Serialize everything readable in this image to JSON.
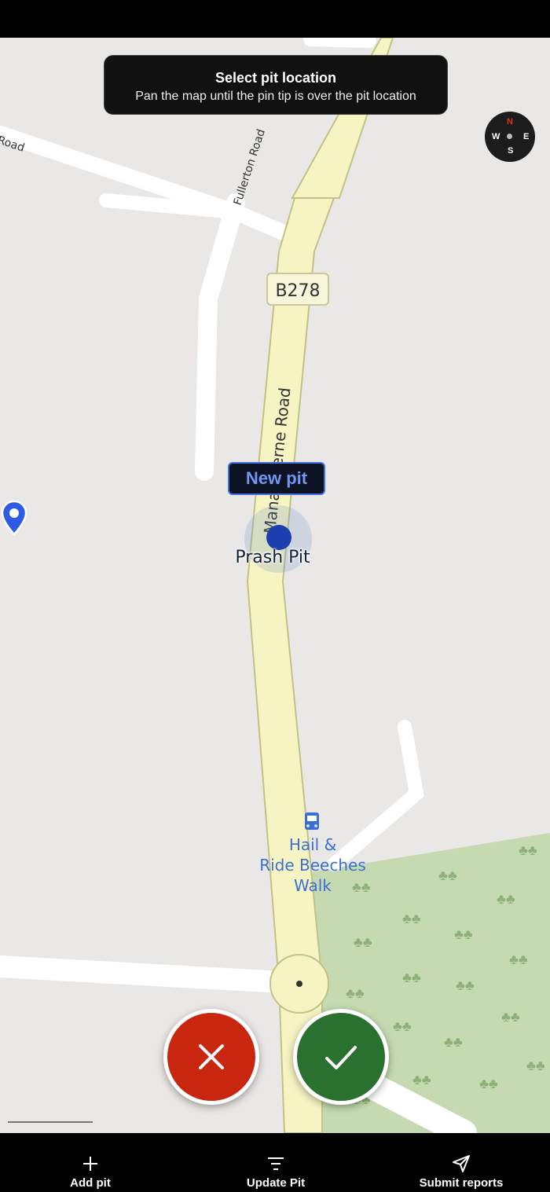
{
  "toast": {
    "title": "Select pit location",
    "subtitle": "Pan the map until the pin tip is over the pit location"
  },
  "compass": {
    "north": "N",
    "south": "S",
    "west": "W",
    "east": "E",
    "north_color": "#e53020"
  },
  "map": {
    "road_labels": {
      "road_left": "Road",
      "fullerton": "Fullerton Road",
      "b278": "B278",
      "manstern": "Manansterne Road"
    },
    "poi": {
      "icon": "bus-stop-icon",
      "line1": "Hail &",
      "line2": "Ride Beeches",
      "line3": "Walk"
    }
  },
  "new_pit": {
    "label": "New pit"
  },
  "existing_pit": {
    "name": "Prash Pit"
  },
  "actions": {
    "cancel_icon": "close-icon",
    "confirm_icon": "check-icon",
    "cancel_color": "#c8260e",
    "confirm_color": "#2a702f"
  },
  "bottom_nav": {
    "items": [
      {
        "label": "Add pit",
        "icon": "plus-icon"
      },
      {
        "label": "Update Pit",
        "icon": "filter-icon"
      },
      {
        "label": "Submit reports",
        "icon": "send-icon"
      }
    ]
  }
}
